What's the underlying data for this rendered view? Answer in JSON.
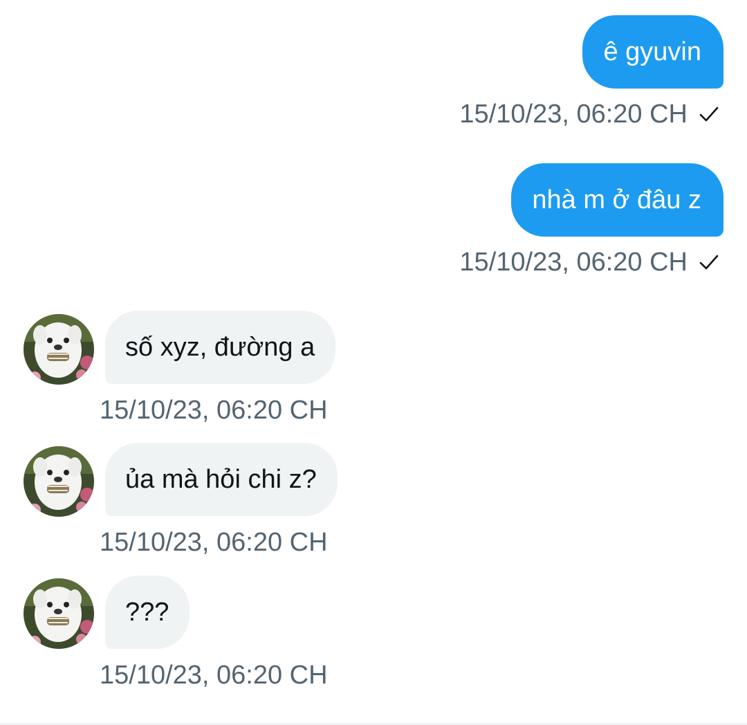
{
  "messages": [
    {
      "direction": "outgoing",
      "text": "ê gyuvin",
      "time": "15/10/23, 06:20 CH",
      "status_icon": "check-icon"
    },
    {
      "direction": "outgoing",
      "text": "nhà m ở đâu z",
      "time": "15/10/23, 06:20 CH",
      "status_icon": "check-icon"
    },
    {
      "direction": "incoming",
      "text": "số xyz, đường a",
      "time": "15/10/23, 06:20 CH",
      "avatar_icon": "dog-avatar"
    },
    {
      "direction": "incoming",
      "text": "ủa mà hỏi chi z?",
      "time": "15/10/23, 06:20 CH",
      "avatar_icon": "dog-avatar"
    },
    {
      "direction": "incoming",
      "text": "???",
      "time": "15/10/23, 06:20 CH",
      "avatar_icon": "dog-avatar"
    }
  ],
  "colors": {
    "outgoing_bubble": "#1d9bf0",
    "incoming_bubble": "#eff3f4",
    "timestamp": "#536471",
    "background": "#ffffff"
  }
}
